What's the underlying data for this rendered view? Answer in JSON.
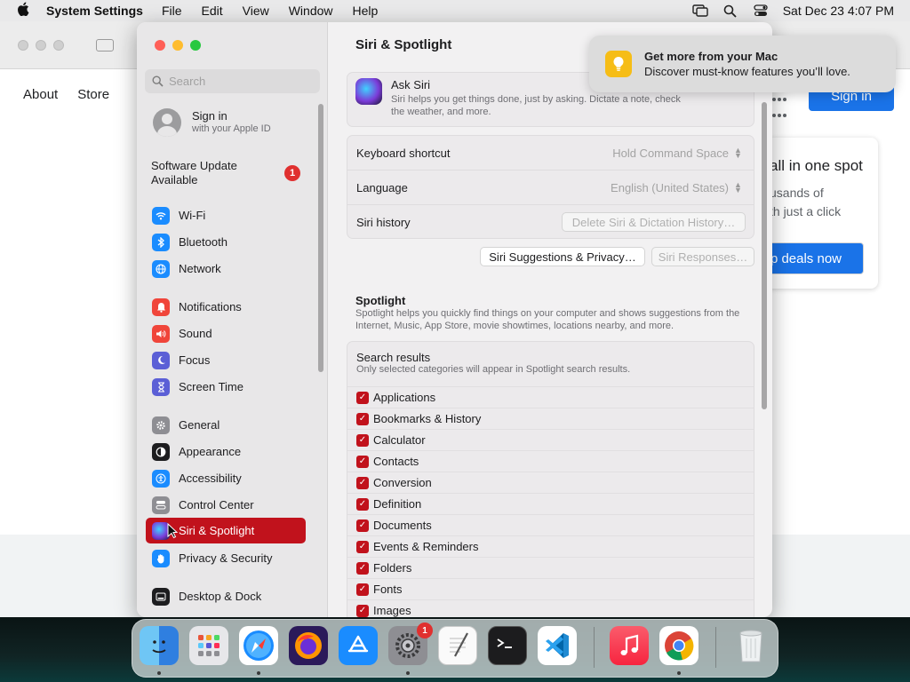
{
  "menubar": {
    "app_name": "System Settings",
    "menus": [
      "File",
      "Edit",
      "View",
      "Window",
      "Help"
    ],
    "clock": "Sat Dec 23  4:07 PM"
  },
  "browser": {
    "links": [
      "About",
      "Store"
    ],
    "signin_label": "Sign in",
    "card_heading": "all in one spot",
    "card_line1": "usands of",
    "card_line2": "th just a click",
    "card_button": "p deals now"
  },
  "notification": {
    "title": "Get more from your Mac",
    "body": "Discover must-know features you’ll love."
  },
  "sidebar": {
    "search_placeholder": "Search",
    "account_title": "Sign in",
    "account_subtitle": "with your Apple ID",
    "update_line1": "Software Update",
    "update_line2": "Available",
    "update_badge": "1",
    "items": [
      {
        "label": "Wi-Fi",
        "icon": "wifi-icon",
        "color": "#1a8cff"
      },
      {
        "label": "Bluetooth",
        "icon": "bluetooth-icon",
        "color": "#1a8cff"
      },
      {
        "label": "Network",
        "icon": "globe-icon",
        "color": "#1a8cff"
      },
      {
        "label": "Notifications",
        "icon": "bell-icon",
        "color": "#f0453a"
      },
      {
        "label": "Sound",
        "icon": "speaker-icon",
        "color": "#f0453a"
      },
      {
        "label": "Focus",
        "icon": "moon-icon",
        "color": "#5b5fd6"
      },
      {
        "label": "Screen Time",
        "icon": "hourglass-icon",
        "color": "#5b5fd6"
      },
      {
        "label": "General",
        "icon": "gear-icon",
        "color": "#8e8e93"
      },
      {
        "label": "Appearance",
        "icon": "appearance-icon",
        "color": "#1d1d1f"
      },
      {
        "label": "Accessibility",
        "icon": "accessibility-icon",
        "color": "#1a8cff"
      },
      {
        "label": "Control Center",
        "icon": "control-center-icon",
        "color": "#8e8e93"
      },
      {
        "label": "Siri & Spotlight",
        "icon": "siri-icon",
        "color": "#6b3fb3"
      },
      {
        "label": "Privacy & Security",
        "icon": "hand-icon",
        "color": "#1a8cff"
      },
      {
        "label": "Desktop & Dock",
        "icon": "dock-icon",
        "color": "#1d1d1f"
      }
    ]
  },
  "content": {
    "title": "Siri & Spotlight",
    "ask_siri_title": "Ask Siri",
    "ask_siri_desc": "Siri helps you get things done, just by asking. Dictate a note, check the weather, and more.",
    "rows": [
      {
        "label": "Keyboard shortcut",
        "value": "Hold Command Space"
      },
      {
        "label": "Language",
        "value": "English (United States)"
      },
      {
        "label": "Siri history",
        "value": "Delete Siri & Dictation History…"
      }
    ],
    "suggestions_button": "Siri Suggestions & Privacy…",
    "responses_button": "Siri Responses…",
    "spotlight_title": "Spotlight",
    "spotlight_desc": "Spotlight helps you quickly find things on your computer and shows suggestions from the Internet, Music, App Store, movie showtimes, locations nearby, and more.",
    "search_results_title": "Search results",
    "search_results_desc": "Only selected categories will appear in Spotlight search results.",
    "categories": [
      "Applications",
      "Bookmarks & History",
      "Calculator",
      "Contacts",
      "Conversion",
      "Definition",
      "Documents",
      "Events & Reminders",
      "Folders",
      "Fonts",
      "Images"
    ]
  },
  "dock": {
    "apps": [
      "Finder",
      "Launchpad",
      "Safari",
      "Firefox",
      "App Store",
      "System Settings",
      "TextEdit",
      "Terminal",
      "Visual Studio Code",
      "Music",
      "Google Chrome",
      "Trash"
    ],
    "settings_badge": "1"
  },
  "colors": {
    "accent": "#c1121c",
    "link_blue": "#1a73e8"
  }
}
